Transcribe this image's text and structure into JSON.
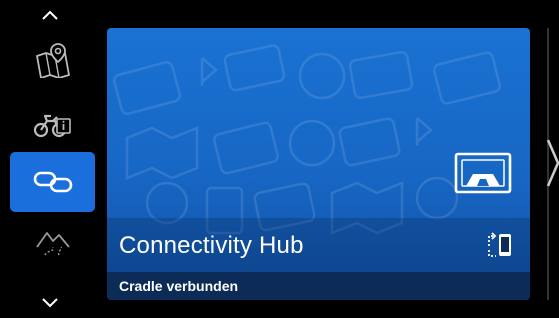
{
  "sidebar": {
    "scroll_up_icon": "chevron-up-icon",
    "scroll_down_icon": "chevron-down-icon",
    "items": [
      {
        "icon": "map-pin-icon",
        "active": false
      },
      {
        "icon": "motorcycle-info-icon",
        "active": false
      },
      {
        "icon": "link-icon",
        "active": true
      },
      {
        "icon": "mountain-road-icon",
        "active": false
      }
    ]
  },
  "hub_card": {
    "title": "Connectivity Hub",
    "status": "Cradle verbunden",
    "card_icon": "cradle-icon",
    "device_icon": "phone-connect-icon"
  },
  "colors": {
    "accent": "#1a6fdc",
    "card_top": "#1a72d2",
    "card_bottom": "#114f9e",
    "status_bar": "#0c2c57",
    "background": "#000000"
  }
}
